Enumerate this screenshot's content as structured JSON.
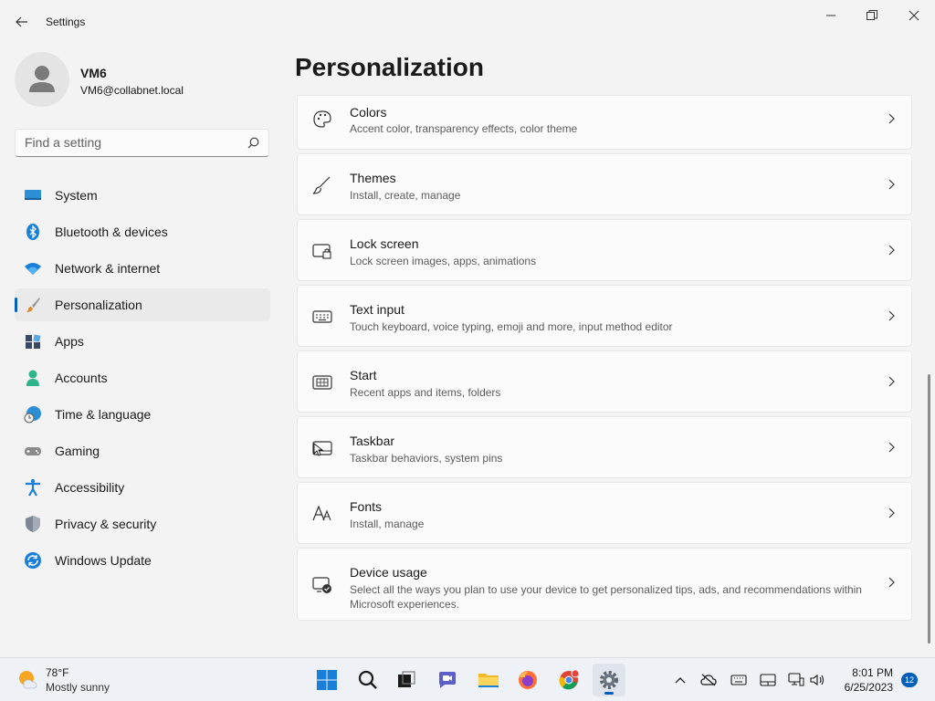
{
  "window": {
    "title": "Settings",
    "controls": [
      "minimize",
      "maximize",
      "close"
    ]
  },
  "profile": {
    "name": "VM6",
    "email": "VM6@collabnet.local"
  },
  "search": {
    "placeholder": "Find a setting"
  },
  "sidebar": {
    "items": [
      {
        "label": "System",
        "icon": "system-icon",
        "active": false
      },
      {
        "label": "Bluetooth & devices",
        "icon": "bluetooth-icon",
        "active": false
      },
      {
        "label": "Network & internet",
        "icon": "wifi-icon",
        "active": false
      },
      {
        "label": "Personalization",
        "icon": "brush-icon",
        "active": true
      },
      {
        "label": "Apps",
        "icon": "apps-icon",
        "active": false
      },
      {
        "label": "Accounts",
        "icon": "accounts-icon",
        "active": false
      },
      {
        "label": "Time & language",
        "icon": "globe-clock-icon",
        "active": false
      },
      {
        "label": "Gaming",
        "icon": "gamepad-icon",
        "active": false
      },
      {
        "label": "Accessibility",
        "icon": "accessibility-icon",
        "active": false
      },
      {
        "label": "Privacy & security",
        "icon": "shield-icon",
        "active": false
      },
      {
        "label": "Windows Update",
        "icon": "update-icon",
        "active": false
      }
    ]
  },
  "main": {
    "title": "Personalization",
    "cards": [
      {
        "title": "Colors",
        "desc": "Accent color, transparency effects, color theme",
        "icon": "palette-icon"
      },
      {
        "title": "Themes",
        "desc": "Install, create, manage",
        "icon": "brush-icon"
      },
      {
        "title": "Lock screen",
        "desc": "Lock screen images, apps, animations",
        "icon": "lock-screen-icon"
      },
      {
        "title": "Text input",
        "desc": "Touch keyboard, voice typing, emoji and more, input method editor",
        "icon": "keyboard-icon"
      },
      {
        "title": "Start",
        "desc": "Recent apps and items, folders",
        "icon": "start-icon"
      },
      {
        "title": "Taskbar",
        "desc": "Taskbar behaviors, system pins",
        "icon": "taskbar-icon"
      },
      {
        "title": "Fonts",
        "desc": "Install, manage",
        "icon": "fonts-icon"
      },
      {
        "title": "Device usage",
        "desc": "Select all the ways you plan to use your device to get personalized tips, ads, and recommendations within Microsoft experiences.",
        "icon": "device-usage-icon"
      }
    ]
  },
  "taskbar": {
    "weather_temp": "78°F",
    "weather_desc": "Mostly sunny",
    "apps": [
      "start-icon",
      "search-icon",
      "task-view-icon",
      "teams-chat-icon",
      "file-explorer-icon",
      "firefox-icon",
      "chrome-icon",
      "settings-icon"
    ],
    "time": "8:01 PM",
    "date": "6/25/2023",
    "notifications": "12"
  },
  "colors": {
    "accent": "#005fb8",
    "background": "#f3f3f3",
    "card": "#fbfbfb"
  }
}
